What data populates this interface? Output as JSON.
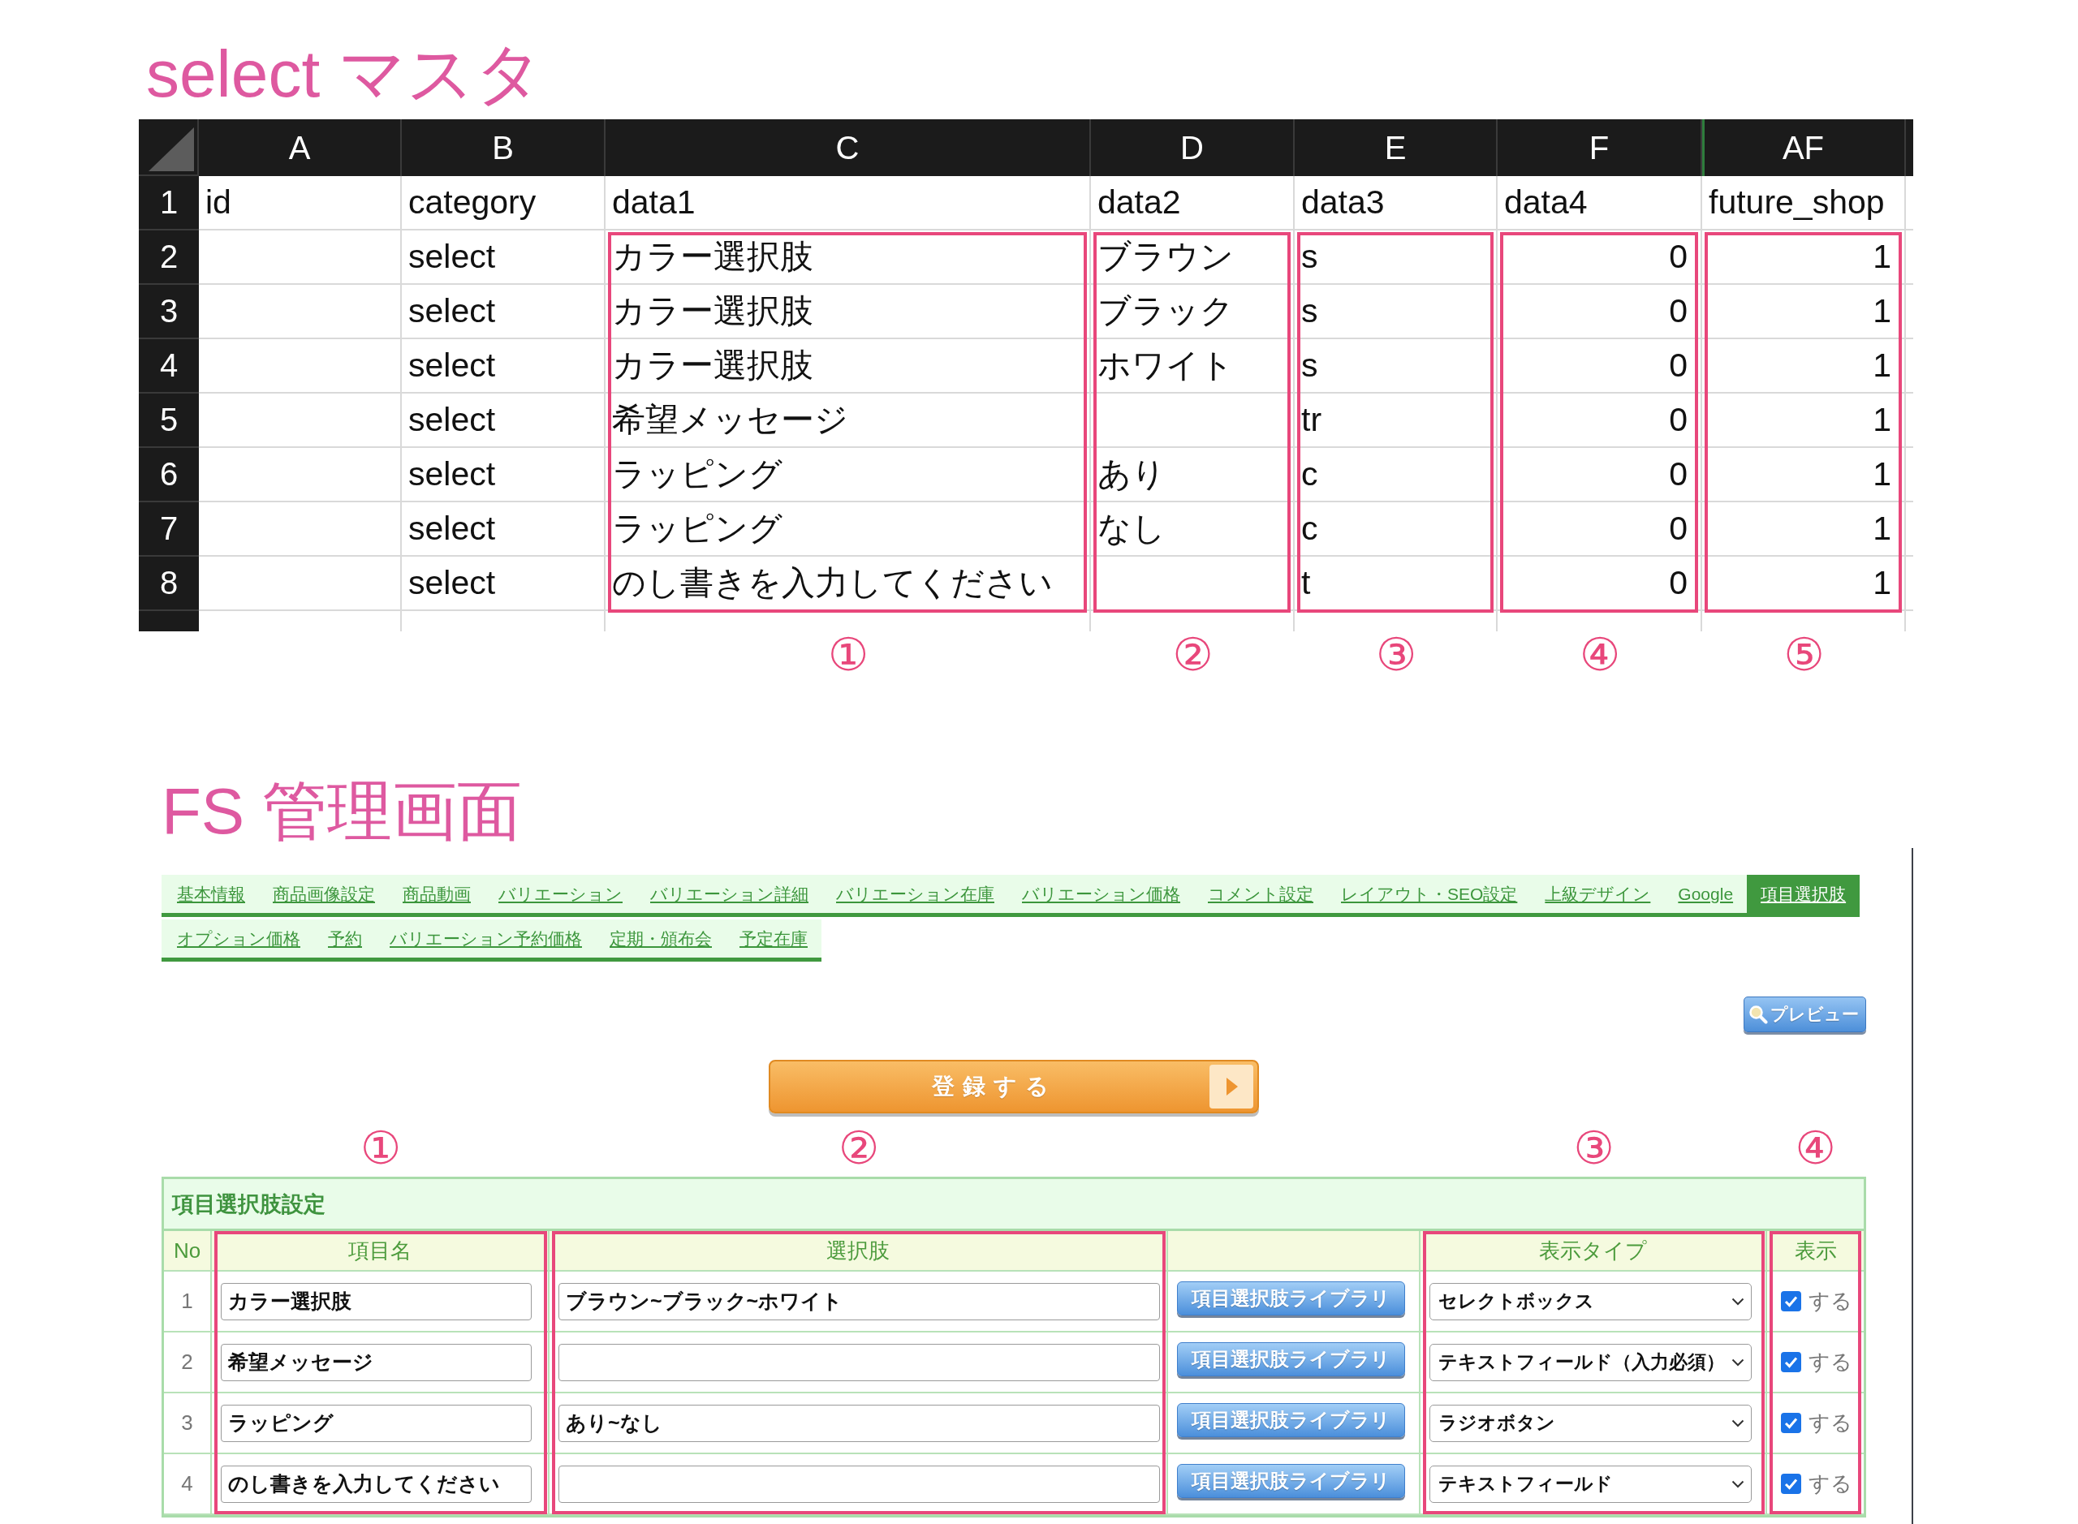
{
  "sheet_title": "select マスタ",
  "sheet": {
    "columns": [
      {
        "letter": "A",
        "highlighted": false
      },
      {
        "letter": "B",
        "numeric": false,
        "highlighted": false
      },
      {
        "letter": "C",
        "numeric": false,
        "highlighted": true,
        "marker": "①"
      },
      {
        "letter": "D",
        "numeric": false,
        "highlighted": true,
        "marker": "②"
      },
      {
        "letter": "E",
        "numeric": false,
        "highlighted": true,
        "marker": "③"
      },
      {
        "letter": "F",
        "numeric": true,
        "highlighted": true,
        "marker": "④"
      },
      {
        "letter": "AF",
        "numeric": true,
        "highlighted": true,
        "marker": "⑤"
      }
    ],
    "rows": [
      {
        "number": "1",
        "kind": "fields",
        "a": "id",
        "b": "category",
        "c": "data1",
        "d": "data2",
        "e": "data3",
        "f": "data4",
        "af": "future_shop"
      },
      {
        "number": "2",
        "kind": "record",
        "b": "select",
        "c": "カラー選択肢",
        "d": "ブラウン",
        "e": "s",
        "f": "0",
        "af": "1"
      },
      {
        "number": "3",
        "kind": "record",
        "b": "select",
        "c": "カラー選択肢",
        "d": "ブラック",
        "e": "s",
        "f": "0",
        "af": "1"
      },
      {
        "number": "4",
        "kind": "record",
        "b": "select",
        "c": "カラー選択肢",
        "d": "ホワイト",
        "e": "s",
        "f": "0",
        "af": "1"
      },
      {
        "number": "5",
        "kind": "record",
        "b": "select",
        "c": "希望メッセージ",
        "e": "tr",
        "f": "0",
        "af": "1"
      },
      {
        "number": "6",
        "kind": "record",
        "b": "select",
        "c": "ラッピング",
        "d": "あり",
        "e": "c",
        "f": "0",
        "af": "1"
      },
      {
        "number": "7",
        "kind": "record",
        "b": "select",
        "c": "ラッピング",
        "d": "なし",
        "e": "c",
        "f": "0",
        "af": "1"
      },
      {
        "number": "8",
        "kind": "record",
        "b": "select",
        "c": "のし書きを入力してください",
        "e": "t",
        "f": "0",
        "af": "1"
      }
    ]
  },
  "admin_title": "FS 管理画面",
  "admin": {
    "tab_rows": [
      {
        "tabs": [
          {
            "label": "基本情報",
            "selected": false
          },
          {
            "label": "商品画像設定",
            "selected": false
          },
          {
            "label": "商品動画",
            "selected": false
          },
          {
            "label": "バリエーション",
            "selected": false
          },
          {
            "label": "バリエーション詳細",
            "selected": false
          },
          {
            "label": "バリエーション在庫",
            "selected": false
          },
          {
            "label": "バリエーション価格",
            "selected": false
          },
          {
            "label": "コメント設定",
            "selected": false
          },
          {
            "label": "レイアウト・SEO設定",
            "selected": false
          },
          {
            "label": "上級デザイン",
            "selected": false
          },
          {
            "label": "Google",
            "selected": false
          },
          {
            "label": "項目選択肢",
            "selected": true
          }
        ]
      },
      {
        "tabs": [
          {
            "label": "オプション価格",
            "selected": false
          },
          {
            "label": "予約",
            "selected": false
          },
          {
            "label": "バリエーション予約価格",
            "selected": false
          },
          {
            "label": "定期・頒布会",
            "selected": false
          },
          {
            "label": "予定在庫",
            "selected": false
          }
        ]
      }
    ],
    "preview_button": "プレビュー",
    "register_button": "登録する",
    "table": {
      "caption": "項目選択肢設定",
      "columns": [
        {
          "label": "No",
          "highlighted": false
        },
        {
          "label": "項目名",
          "highlighted": true,
          "marker": "①"
        },
        {
          "label": "選択肢",
          "highlighted": true,
          "marker": "②"
        },
        {
          "highlighted": false
        },
        {
          "label": "表示タイプ",
          "highlighted": true,
          "marker": "③"
        },
        {
          "label": "表示",
          "highlighted": true,
          "marker": "④"
        }
      ],
      "rows": [
        {
          "no": "1",
          "name": "カラー選択肢",
          "choices": "ブラウン~ブラック~ホワイト",
          "library_button": "項目選択肢ライブラリ",
          "display_type": "セレクトボックス",
          "show": {
            "checked": true,
            "label": "する"
          }
        },
        {
          "no": "2",
          "name": "希望メッセージ",
          "library_button": "項目選択肢ライブラリ",
          "display_type": "テキストフィールド（入力必須）",
          "show": {
            "checked": true,
            "label": "する"
          }
        },
        {
          "no": "3",
          "name": "ラッピング",
          "choices": "あり~なし",
          "library_button": "項目選択肢ライブラリ",
          "display_type": "ラジオボタン",
          "show": {
            "checked": true,
            "label": "する"
          }
        },
        {
          "no": "4",
          "name": "のし書きを入力してください",
          "library_button": "項目選択肢ライブラリ",
          "display_type": "テキストフィールド",
          "show": {
            "checked": true,
            "label": "する"
          }
        }
      ]
    }
  }
}
